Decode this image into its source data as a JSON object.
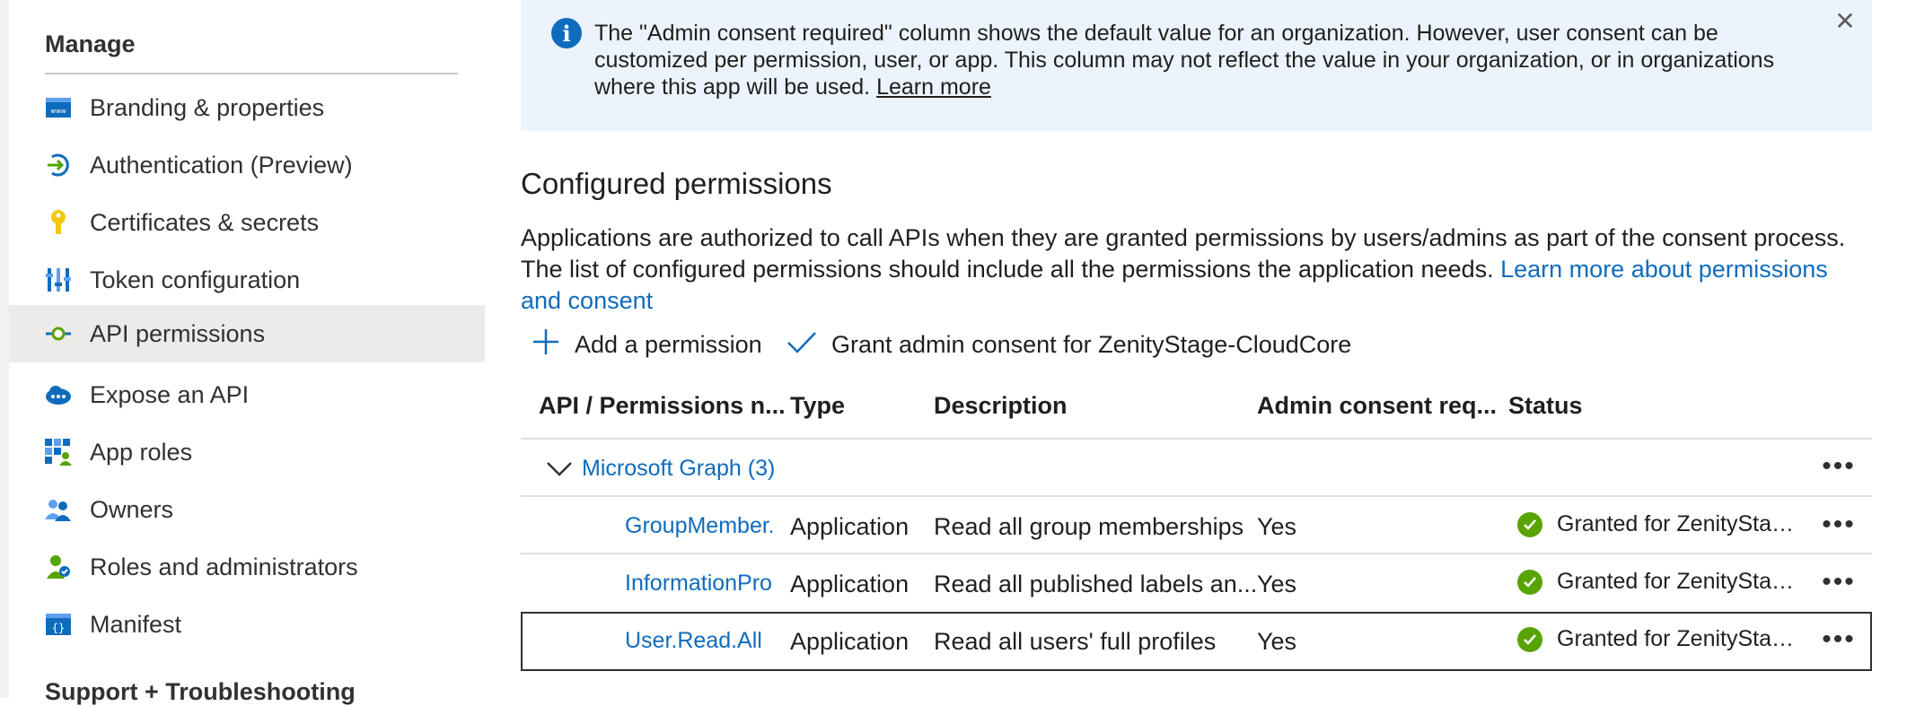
{
  "sidebar": {
    "section_title": "Manage",
    "items": [
      {
        "label": "Branding & properties",
        "icon": "branding-icon"
      },
      {
        "label": "Authentication (Preview)",
        "icon": "authentication-icon"
      },
      {
        "label": "Certificates & secrets",
        "icon": "key-icon"
      },
      {
        "label": "Token configuration",
        "icon": "token-icon"
      },
      {
        "label": "API permissions",
        "icon": "api-permissions-icon",
        "active": true
      },
      {
        "label": "Expose an API",
        "icon": "cloud-icon"
      },
      {
        "label": "App roles",
        "icon": "app-roles-icon"
      },
      {
        "label": "Owners",
        "icon": "owners-icon"
      },
      {
        "label": "Roles and administrators",
        "icon": "roles-admins-icon"
      },
      {
        "label": "Manifest",
        "icon": "manifest-icon"
      }
    ],
    "support_title": "Support + Troubleshooting"
  },
  "banner": {
    "message": "The \"Admin consent required\" column shows the default value for an organization. However, user consent can be customized per permission, user, or app. This column may not reflect the value in your organization, or in organizations where this app will be used.",
    "link": "Learn more",
    "close_icon": "close-icon"
  },
  "configured": {
    "title": "Configured permissions",
    "description": "Applications are authorized to call APIs when they are granted permissions by users/admins as part of the consent process. The list of configured permissions should include all the permissions the application needs.",
    "link": "Learn more about permissions and consent"
  },
  "toolbar": {
    "add_label": "Add a permission",
    "grant_label": "Grant admin consent for ZenityStage-CloudCore"
  },
  "table": {
    "headers": [
      "API / Permissions n...",
      "Type",
      "Description",
      "Admin consent req...",
      "Status"
    ],
    "group": "Microsoft Graph (3)",
    "rows": [
      {
        "name": "GroupMember.Read.All",
        "type": "Application",
        "description": "Read all group memberships",
        "admin_consent": "Yes",
        "status": "Granted for ZenityStage-CloudCore"
      },
      {
        "name": "InformationProtectionPolicy.Read.All",
        "type": "Application",
        "description": "Read all published labels an...",
        "admin_consent": "Yes",
        "status": "Granted for ZenityStage-CloudCore"
      },
      {
        "name": "User.Read.All",
        "type": "Application",
        "description": "Read all users' full profiles",
        "admin_consent": "Yes",
        "status": "Granted for ZenityStage-CloudCore"
      }
    ],
    "more_label": "•••"
  },
  "colors": {
    "accent": "#0f6cbd",
    "success": "#57a300",
    "banner_bg": "#ebf3fc",
    "active_bg": "#edebe9"
  }
}
